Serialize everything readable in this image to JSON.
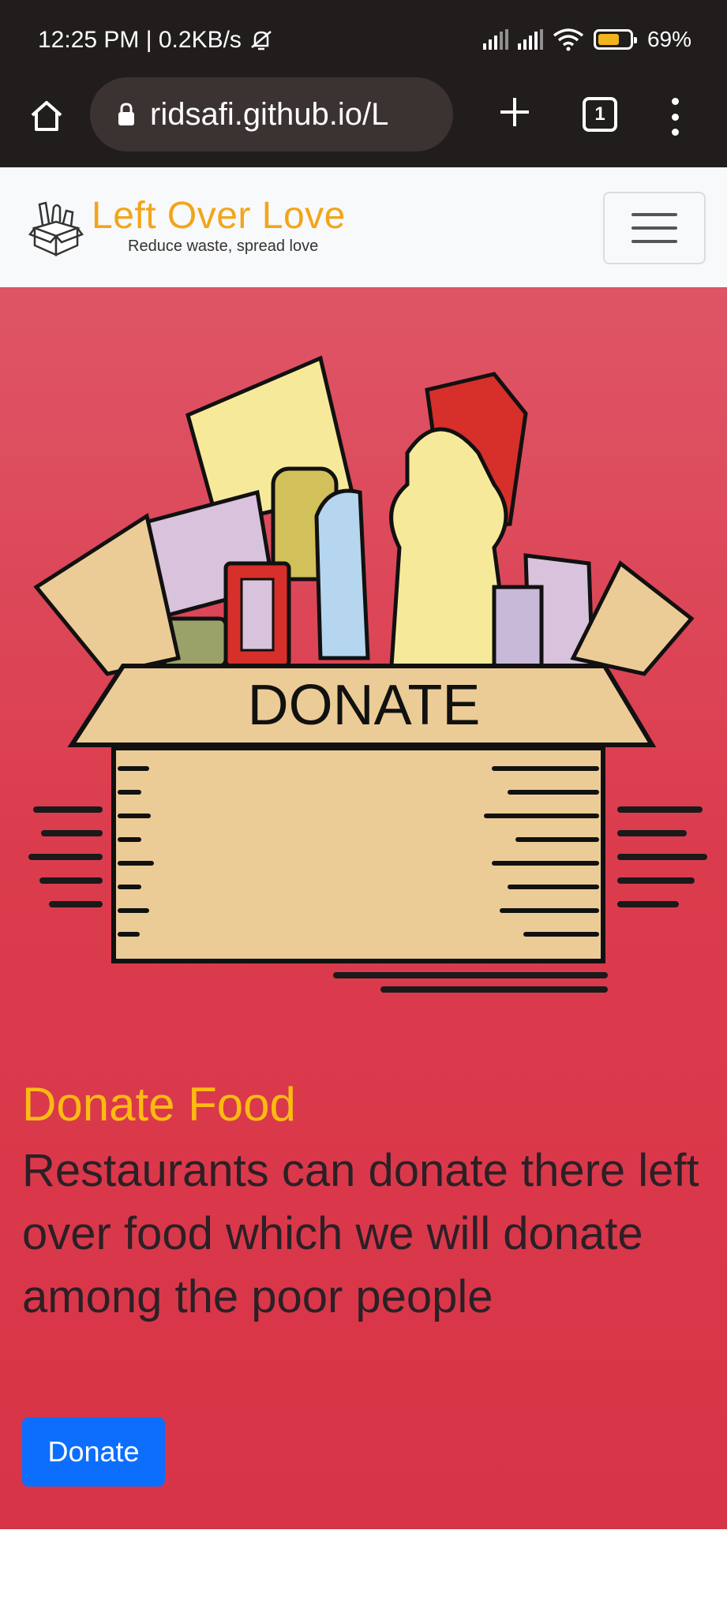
{
  "status_bar": {
    "time_and_speed": "12:25 PM | 0.2KB/s",
    "battery_percent": "69%",
    "battery_level": 0.69
  },
  "browser": {
    "url": "ridsafi.github.io/L",
    "tab_count": "1"
  },
  "navbar": {
    "brand_title": "Left Over Love",
    "brand_tagline": "Reduce waste, spread love"
  },
  "hero": {
    "box_label": "DONATE",
    "heading": "Donate Food",
    "description": "Restaurants can donate there left over food which we will donate among the poor people",
    "button_label": "Donate"
  },
  "colors": {
    "hero_background": "#db3c4d",
    "heading": "#fdbb12",
    "brand": "#f2a51a",
    "button": "#0d6efd"
  }
}
